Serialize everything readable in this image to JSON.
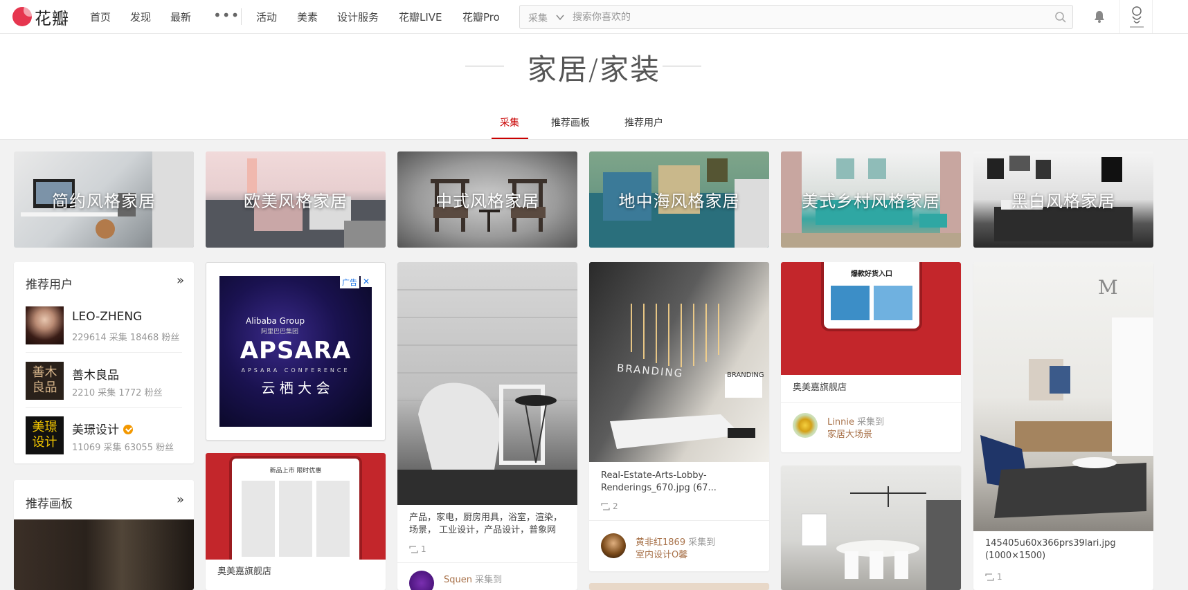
{
  "header": {
    "logo_text": "花瓣",
    "nav": [
      "首页",
      "发现",
      "最新"
    ],
    "more": "•••",
    "nav2": [
      "活动",
      "美素",
      "设计服务",
      "花瓣LIVE",
      "花瓣Pro"
    ],
    "search_type": "采集",
    "search_placeholder": "搜索你喜欢的"
  },
  "hero": {
    "title": "家居/家装",
    "tabs": [
      "采集",
      "推荐画板",
      "推荐用户"
    ],
    "active_tab": "采集"
  },
  "categories": [
    "简约风格家居",
    "欧美风格家居",
    "中式风格家居",
    "地中海风格家居",
    "美式乡村风格家居",
    "黑白风格家居"
  ],
  "sidebar": {
    "users_title": "推荐用户",
    "more": "»",
    "users": [
      {
        "name": "LEO-ZHENG",
        "stats": "229614 采集  18468 粉丝"
      },
      {
        "name": "善木良品",
        "stats": "2210 采集  1772 粉丝"
      },
      {
        "name": "美璟设计",
        "stats": "11069 采集  63055 粉丝"
      }
    ],
    "boards_title": "推荐画板",
    "avatar_text_1": "善木\n良品",
    "avatar_text_2": "美璟\n设计"
  },
  "ad": {
    "tag": "广告",
    "close": "✕",
    "brand_top": "Alibaba Group",
    "brand_sub": "阿里巴巴集团",
    "title": "APSARA",
    "subtitle": "APSARA CONFERENCE",
    "cn": "云 栖 大 会"
  },
  "pins": {
    "col2_store": "奥美嘉旗舰店",
    "col2_banner": "新品上市 限时优惠",
    "col3_desc": "产品，家电，厨房用具，浴室，渲染，场景， 工业设计，产品设计，普象网",
    "col3_repins": "1",
    "col3_user": "Squen",
    "col3_action": "采集到",
    "col4_text1": "BRANDING",
    "col4_text2": "BRANDING",
    "col4_desc": "Real-Estate-Arts-Lobby-Renderings_670.jpg (67...",
    "col4_repins": "2",
    "col4_user": "黄非红1869",
    "col4_action": "采集到",
    "col4_board": "室内设计O馨",
    "col5_banner": "爆款好货入口",
    "col5_store": "奥美嘉旗舰店",
    "col5_user": "Linnie",
    "col5_action": "采集到",
    "col5_board": "家居大场景",
    "col6_logo": "M",
    "col6_desc": "145405u60x366prs39lari.jpg (1000×1500)",
    "col6_repins": "1"
  }
}
